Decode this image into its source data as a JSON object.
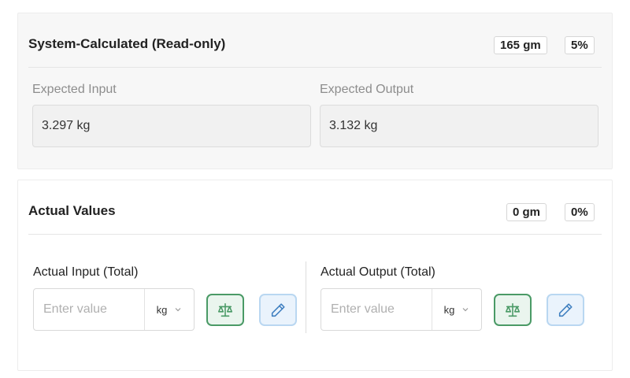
{
  "system": {
    "title": "System-Calculated (Read-only)",
    "badge_weight": "165 gm",
    "badge_percent": "5%",
    "expected_input": {
      "label": "Expected Input",
      "value": "3.297 kg"
    },
    "expected_output": {
      "label": "Expected Output",
      "value": "3.132 kg"
    }
  },
  "actual": {
    "title": "Actual Values",
    "badge_weight": "0 gm",
    "badge_percent": "0%",
    "input": {
      "label": "Actual Input (Total)",
      "placeholder": "Enter value",
      "unit": "kg"
    },
    "output": {
      "label": "Actual Output (Total)",
      "placeholder": "Enter value",
      "unit": "kg"
    }
  },
  "icons": {
    "weigh": "scale-icon",
    "edit": "pencil-icon",
    "dropdown": "chevron-down-icon"
  },
  "colors": {
    "scale_accent": "#4a9a66",
    "edit_accent": "#3f7fc0"
  }
}
